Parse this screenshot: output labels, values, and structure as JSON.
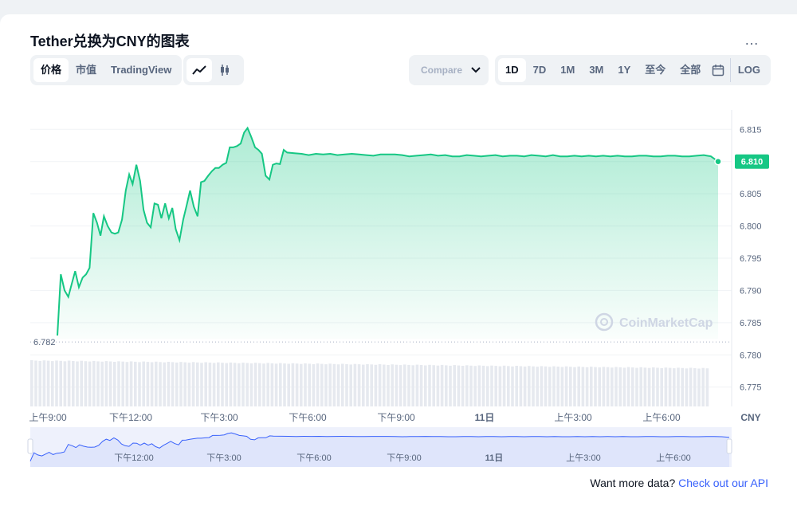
{
  "title": "Tether兑换为CNY的图表",
  "more_icon": "…",
  "view_tabs": [
    {
      "label": "价格",
      "active": true
    },
    {
      "label": "市值",
      "active": false
    },
    {
      "label": "TradingView",
      "active": false
    }
  ],
  "chart_style_icons": [
    "line-chart-icon",
    "candlestick-icon"
  ],
  "compare": {
    "label": "Compare"
  },
  "ranges": [
    {
      "label": "1D",
      "active": true
    },
    {
      "label": "7D",
      "active": false
    },
    {
      "label": "1M",
      "active": false
    },
    {
      "label": "3M",
      "active": false
    },
    {
      "label": "1Y",
      "active": false
    },
    {
      "label": "至今",
      "active": false
    },
    {
      "label": "全部",
      "active": false
    }
  ],
  "log_label": "LOG",
  "api": {
    "text": "Want more data?",
    "link": "Check out our API"
  },
  "colors": {
    "line": "#16c784",
    "accent": "#3861fb",
    "navigator_fill": "#dfe5fb"
  },
  "chart_data": {
    "type": "area",
    "watermark": "CoinMarketCap",
    "y_unit": "CNY",
    "ylim": [
      6.772,
      6.818
    ],
    "y_ticks": [
      "6.815",
      "6.810",
      "6.805",
      "6.800",
      "6.795",
      "6.790",
      "6.785",
      "6.780",
      "6.775"
    ],
    "x_ticks": [
      "上午9:00",
      "下午12:00",
      "下午3:00",
      "下午6:00",
      "下午9:00",
      "11日",
      "上午3:00",
      "上午6:00"
    ],
    "navigator_ticks": [
      "下午12:00",
      "下午3:00",
      "下午6:00",
      "下午9:00",
      "11日",
      "上午3:00",
      "上午6:00"
    ],
    "open_value": "6.782",
    "current_value": "6.810",
    "series": [
      {
        "x": [
          0.0,
          0.12,
          0.25,
          0.38,
          0.5,
          0.62,
          0.75,
          0.88,
          1.0,
          1.12,
          1.25,
          1.38,
          1.5,
          1.62,
          1.75,
          1.88,
          2.0,
          2.12,
          2.25,
          2.38,
          2.5,
          2.62,
          2.75,
          2.88,
          3.0,
          3.12,
          3.25,
          3.38,
          3.5,
          3.62,
          3.75,
          3.88,
          4.0,
          4.12,
          4.25,
          4.38,
          4.5,
          4.62,
          4.75,
          4.88,
          5.0,
          5.12,
          5.25,
          5.38,
          5.5,
          5.62,
          5.75,
          5.88,
          6.0,
          6.12,
          6.25,
          6.38,
          6.5,
          6.62,
          6.75,
          6.88,
          7.0,
          7.12,
          7.25,
          7.38,
          7.5,
          7.62,
          7.75,
          7.88,
          8.0,
          8.25,
          8.5,
          8.75,
          9.0,
          9.25,
          9.5,
          9.75,
          10.0,
          10.25,
          10.5,
          10.75,
          11.0,
          11.25,
          11.5,
          11.75,
          12.0,
          12.25,
          12.5,
          12.75,
          13.0,
          13.25,
          13.5,
          13.75,
          14.0,
          14.25,
          14.5,
          14.75,
          15.0,
          15.25,
          15.5,
          15.75,
          16.0,
          16.25,
          16.5,
          16.75,
          17.0,
          17.25,
          17.5,
          17.75,
          18.0,
          18.25,
          18.5,
          18.75,
          19.0,
          19.25,
          19.5,
          19.75,
          20.0,
          20.25,
          20.5,
          20.75,
          21.0,
          21.25,
          21.5,
          21.75,
          22.0,
          22.25,
          22.5,
          22.75,
          23.0
        ],
        "values": [
          6.783,
          6.7925,
          6.79,
          6.789,
          6.791,
          6.793,
          6.7905,
          6.792,
          6.7925,
          6.7935,
          6.802,
          6.8005,
          6.7985,
          6.8015,
          6.8,
          6.799,
          6.7988,
          6.799,
          6.801,
          6.8055,
          6.808,
          6.8065,
          6.8095,
          6.807,
          6.8025,
          6.8005,
          6.7998,
          6.8035,
          6.8033,
          6.8012,
          6.8035,
          6.8012,
          6.8028,
          6.7995,
          6.7978,
          6.801,
          6.8032,
          6.8055,
          6.803,
          6.8015,
          6.8068,
          6.807,
          6.8078,
          6.8085,
          6.809,
          6.809,
          6.8095,
          6.8098,
          6.8122,
          6.8122,
          6.8124,
          6.8128,
          6.8145,
          6.8152,
          6.8138,
          6.8122,
          6.8118,
          6.8112,
          6.8078,
          6.8072,
          6.8095,
          6.8097,
          6.8096,
          6.8118,
          6.8114,
          6.8113,
          6.8112,
          6.811,
          6.8112,
          6.8111,
          6.8112,
          6.811,
          6.8111,
          6.8112,
          6.8111,
          6.811,
          6.8109,
          6.8111,
          6.8111,
          6.8111,
          6.811,
          6.8108,
          6.8109,
          6.811,
          6.8111,
          6.8109,
          6.811,
          6.8108,
          6.8108,
          6.811,
          6.8109,
          6.8108,
          6.8109,
          6.811,
          6.8108,
          6.8109,
          6.8109,
          6.8108,
          6.811,
          6.8109,
          6.8108,
          6.811,
          6.8108,
          6.8108,
          6.8109,
          6.8108,
          6.8109,
          6.8108,
          6.8109,
          6.8108,
          6.8109,
          6.8108,
          6.8108,
          6.8109,
          6.8109,
          6.8108,
          6.8108,
          6.8109,
          6.8109,
          6.8108,
          6.8108,
          6.8109,
          6.811,
          6.8108,
          6.81
        ]
      }
    ]
  }
}
